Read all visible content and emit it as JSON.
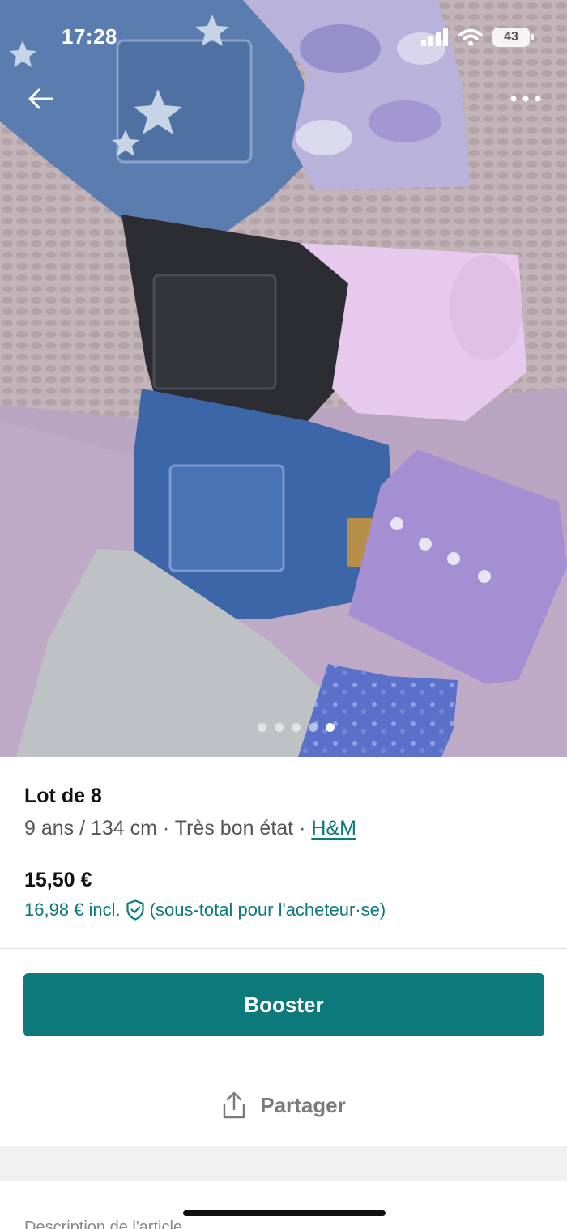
{
  "status_bar": {
    "time": "17:28",
    "battery": "43"
  },
  "nav": {
    "back_icon": "arrow-left-icon",
    "more_icon": "more-horizontal-icon"
  },
  "gallery": {
    "total_images": 5,
    "active_index": 4
  },
  "item": {
    "title": "Lot de 8",
    "size": "9 ans / 134 cm",
    "separator": " · ",
    "condition": "Très bon état",
    "brand": "H&M",
    "price": "15,50 €",
    "price_incl_amount": "16,98 € incl.",
    "price_incl_note": "(sous-total pour l'acheteur·se)"
  },
  "actions": {
    "booster_label": "Booster",
    "share_label": "Partager"
  },
  "section": {
    "description_label": "Description de l'article"
  },
  "colors": {
    "accent": "#0c7a7a",
    "text_primary": "#111111",
    "text_secondary": "#555555"
  }
}
